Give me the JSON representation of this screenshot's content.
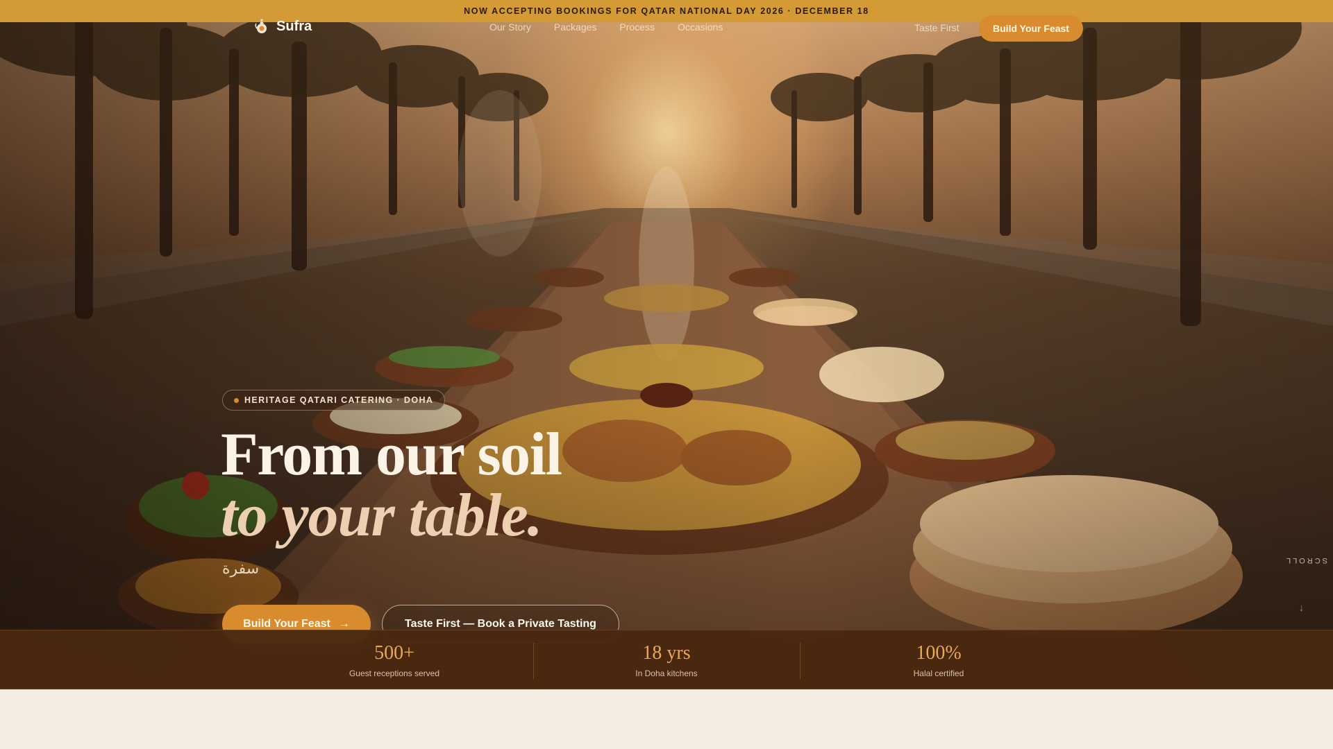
{
  "announcement": {
    "text": "NOW ACCEPTING BOOKINGS FOR QATAR NATIONAL DAY 2026 · DECEMBER 18"
  },
  "nav": {
    "brand": "Sufra",
    "brand_icon": "dallah-coffee-pot-icon",
    "links": [
      "Our Story",
      "Packages",
      "Process",
      "Occasions"
    ],
    "secondary_link": "Taste First",
    "cta": "Build Your Feast"
  },
  "hero": {
    "eyebrow": "HERITAGE QATARI CATERING · DOHA",
    "headline_line1": "From our soil",
    "headline_line2": "to your table.",
    "arabic": "سفرة",
    "primary_button": "Build Your Feast",
    "primary_button_icon": "arrow-right-icon",
    "secondary_button": "Taste First — Book a Private Tasting",
    "scroll_label": "SCROLL",
    "scroll_icon": "arrow-down-icon",
    "background": "long outdoor feast table with rice, chicken, breads and salads under palm trees at sunset"
  },
  "stats": [
    {
      "value": "500+",
      "label": "Guest receptions served"
    },
    {
      "value": "18 yrs",
      "label": "In Doha kitchens"
    },
    {
      "value": "100%",
      "label": "Halal certified"
    }
  ],
  "colors": {
    "announcement_bg": "#d49a35",
    "accent": "#d88c2e",
    "stats_bg": "#4a2810",
    "stat_value": "#e8a857",
    "page_bg": "#f4ece1"
  }
}
